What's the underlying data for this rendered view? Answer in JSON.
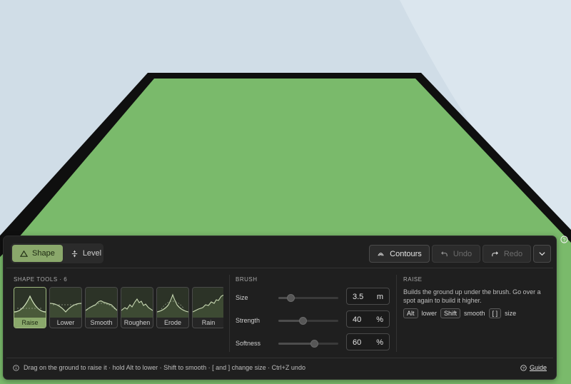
{
  "colors": {
    "sky": "#d0dde7",
    "terrain": "#7aba6b",
    "terrain_edge": "#0f0f0f",
    "accent": "#8aa86b",
    "panel_bg": "#1f1f1f"
  },
  "modes": [
    {
      "label": "Shape",
      "icon": "triangle-icon",
      "active": true
    },
    {
      "label": "Level",
      "icon": "level-icon",
      "active": false
    }
  ],
  "toolbar": {
    "contours_label": "Contours",
    "undo_label": "Undo",
    "redo_label": "Redo"
  },
  "shape_tools": {
    "title": "SHAPE TOOLS · 6",
    "items": [
      {
        "label": "Raise",
        "active": true
      },
      {
        "label": "Lower",
        "active": false
      },
      {
        "label": "Smooth",
        "active": false
      },
      {
        "label": "Roughen",
        "active": false
      },
      {
        "label": "Erode",
        "active": false
      },
      {
        "label": "Rain",
        "active": false
      }
    ]
  },
  "brush": {
    "title": "BRUSH",
    "size": {
      "label": "Size",
      "value": "3.5",
      "unit": "m",
      "level": 0.2
    },
    "strength": {
      "label": "Strength",
      "value": "40",
      "unit": "%",
      "level": 0.4
    },
    "softness": {
      "label": "Softness",
      "value": "60",
      "unit": "%",
      "level": 0.6
    }
  },
  "info": {
    "title": "RAISE",
    "description": "Builds the ground up under the brush. Go over a spot again to build it higher.",
    "keys": [
      {
        "key": "Alt",
        "action": "lower"
      },
      {
        "key": "Shift",
        "action": "smooth"
      },
      {
        "key": "[ ]",
        "action": "size"
      }
    ]
  },
  "footer": {
    "hint": "Drag on the ground to raise it · hold Alt to lower · Shift to smooth · [ and ] change size · Ctrl+Z undo",
    "guide_label": "Guide"
  }
}
